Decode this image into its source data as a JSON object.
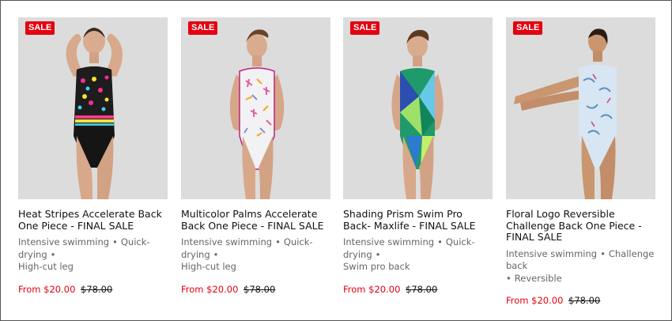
{
  "products": [
    {
      "badge": "SALE",
      "title": "Heat Stripes Accelerate Back One Piece - FINAL SALE",
      "tags": [
        "Intensive swimming",
        "Quick-drying",
        "High-cut leg"
      ],
      "price_label": "From $20.00",
      "original_price": "$78.00"
    },
    {
      "badge": "SALE",
      "title": "Multicolor Palms Accelerate Back One Piece - FINAL SALE",
      "tags": [
        "Intensive swimming",
        "Quick-drying",
        "High-cut leg"
      ],
      "price_label": "From $20.00",
      "original_price": "$78.00"
    },
    {
      "badge": "SALE",
      "title": "Shading Prism Swim Pro Back- Maxlife - FINAL SALE",
      "tags": [
        "Intensive swimming",
        "Quick-drying",
        "Swim pro back"
      ],
      "price_label": "From $20.00",
      "original_price": "$78.00"
    },
    {
      "badge": "SALE",
      "title": "Floral Logo Reversible Challenge Back One Piece - FINAL SALE",
      "tags": [
        "Intensive swimming",
        "Challenge back",
        "Reversible"
      ],
      "price_label": "From $20.00",
      "original_price": "$78.00"
    }
  ],
  "separator": "•",
  "colors": {
    "sale_red": "#e3000f",
    "image_bg": "#dcdcdc",
    "tag_gray": "#666666"
  },
  "icons": {
    "product_image_0": "model-in-black-neon-swimsuit",
    "product_image_1": "model-in-white-palm-print-swimsuit",
    "product_image_2": "model-in-green-blue-prism-swimsuit",
    "product_image_3": "model-in-light-blue-floral-swimsuit-stretching"
  }
}
